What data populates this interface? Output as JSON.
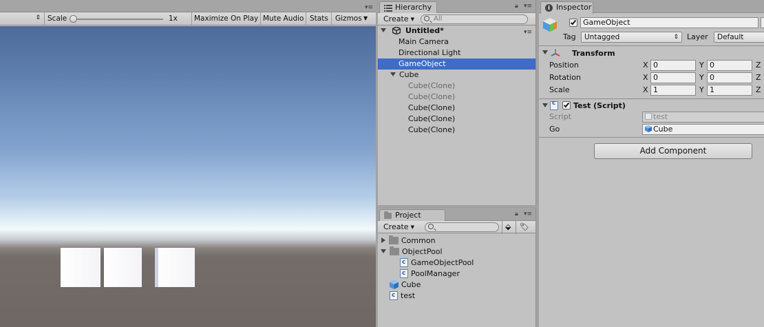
{
  "game_view": {
    "toolbar": {
      "display_value": "",
      "scale_label": "Scale",
      "scale_value": "1x",
      "maximize_on_play": "Maximize On Play",
      "mute_audio": "Mute Audio",
      "stats": "Stats",
      "gizmos": "Gizmos"
    }
  },
  "hierarchy": {
    "tab_label": "Hierarchy",
    "create_label": "Create",
    "search_placeholder": "All",
    "scene_name": "Untitled*",
    "items": [
      {
        "label": "Main Camera"
      },
      {
        "label": "Directional Light"
      },
      {
        "label": "GameObject",
        "selected": true
      },
      {
        "label": "Cube"
      },
      {
        "label": "Cube(Clone)",
        "inactive": true
      },
      {
        "label": "Cube(Clone)",
        "inactive": true
      },
      {
        "label": "Cube(Clone)"
      },
      {
        "label": "Cube(Clone)"
      },
      {
        "label": "Cube(Clone)"
      }
    ]
  },
  "project": {
    "tab_label": "Project",
    "create_label": "Create",
    "search_placeholder": "",
    "items": [
      {
        "label": "Common",
        "icon": "folder-icon"
      },
      {
        "label": "ObjectPool",
        "icon": "folder-icon"
      },
      {
        "label": "GameObjectPool",
        "icon": "script-icon"
      },
      {
        "label": "PoolManager",
        "icon": "script-icon"
      },
      {
        "label": "Cube",
        "icon": "prefab-icon"
      },
      {
        "label": "test",
        "icon": "script-icon"
      }
    ]
  },
  "inspector": {
    "tab_label": "Inspector",
    "object_name": "GameObject",
    "tag_label": "Tag",
    "tag_value": "Untagged",
    "layer_label": "Layer",
    "layer_value": "Default",
    "transform": {
      "title": "Transform",
      "position_label": "Position",
      "rotation_label": "Rotation",
      "scale_label": "Scale",
      "axis_x": "X",
      "axis_y": "Y",
      "axis_z": "Z",
      "position": {
        "x": "0",
        "y": "0"
      },
      "rotation": {
        "x": "0",
        "y": "0"
      },
      "scale": {
        "x": "1",
        "y": "1"
      }
    },
    "script_component": {
      "title": "Test (Script)",
      "script_label": "Script",
      "script_value": "test",
      "go_label": "Go",
      "go_value": "Cube"
    },
    "add_component_label": "Add Component"
  },
  "colors": {
    "selection": "#3e6cc6",
    "panel_bg": "#c2c2c2"
  }
}
